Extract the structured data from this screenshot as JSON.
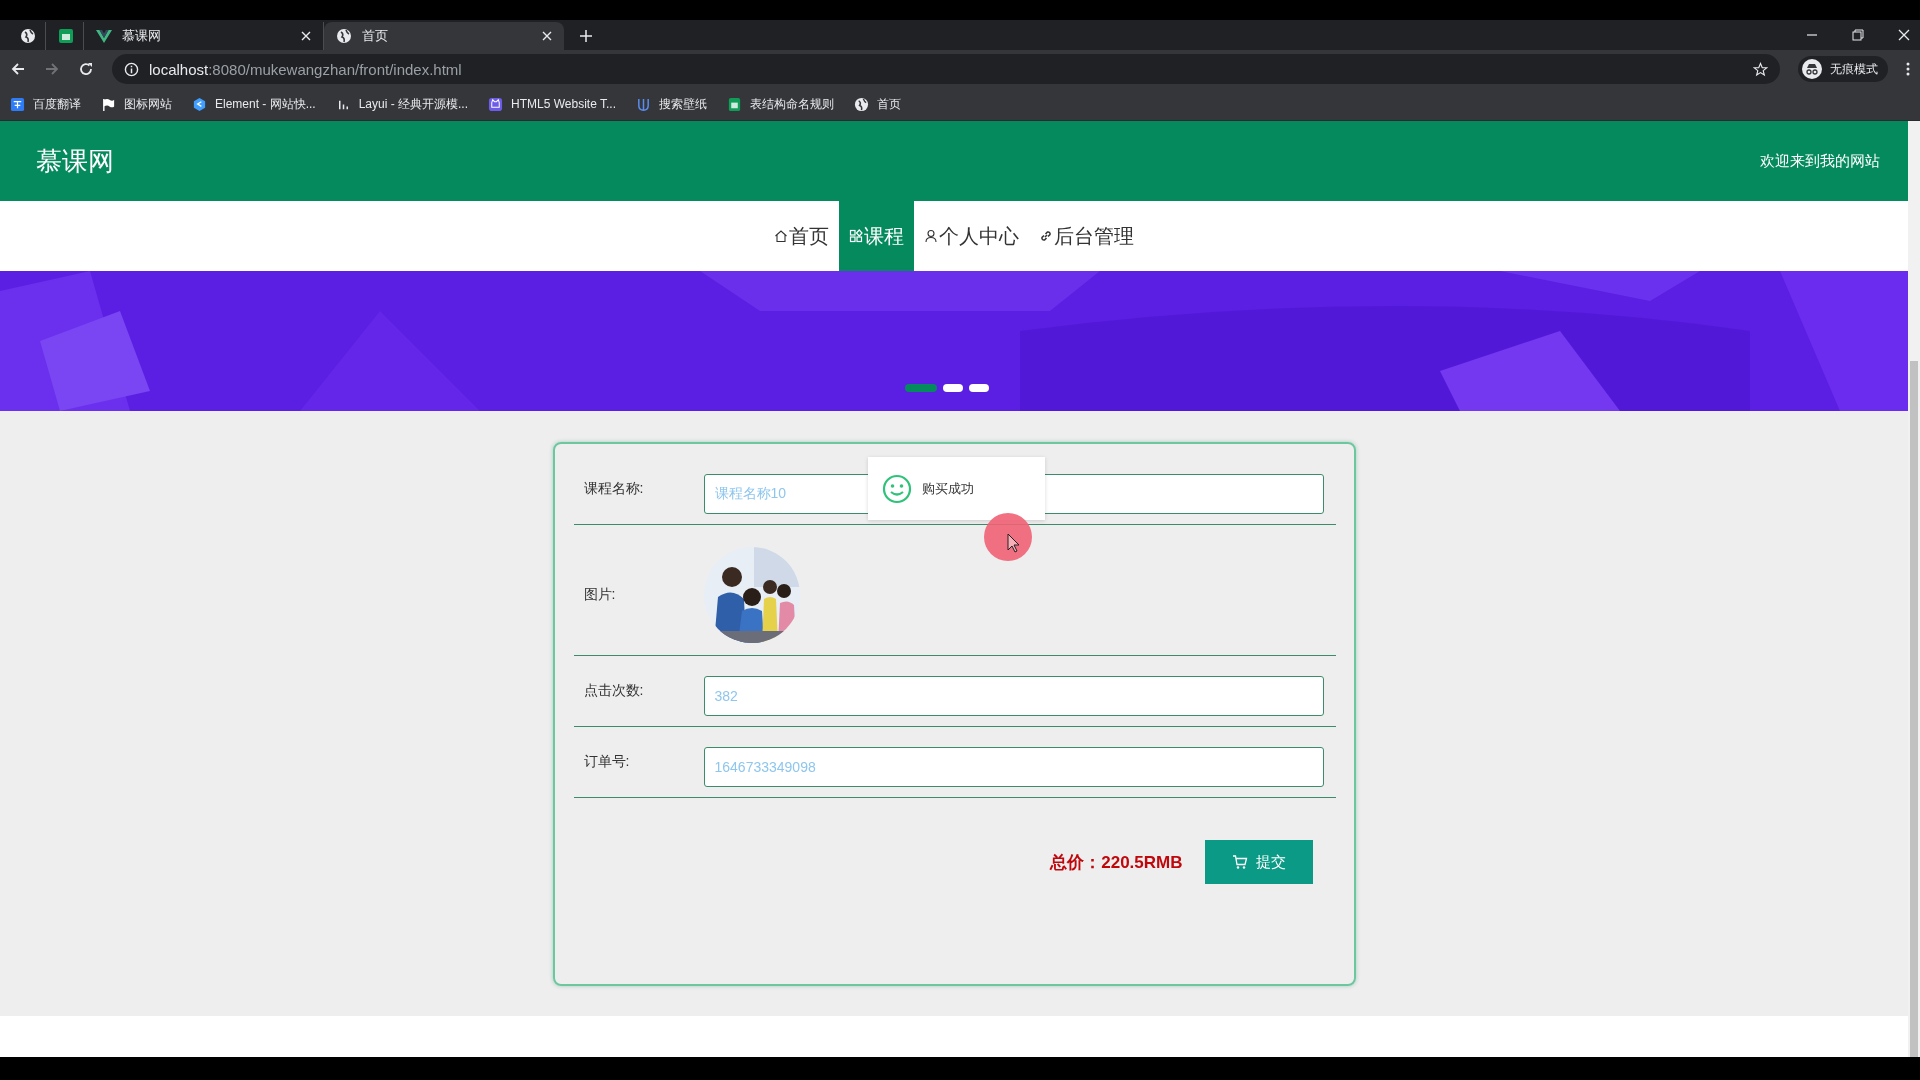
{
  "browser": {
    "tabs": [
      {
        "kind": "globe",
        "selected": false
      },
      {
        "kind": "sheet",
        "selected": false
      },
      {
        "kind": "vue",
        "title": "慕课网",
        "selected": false
      },
      {
        "kind": "globe",
        "title": "首页",
        "selected": true
      }
    ],
    "url": {
      "host": "localhost",
      "path": ":8080/mukewangzhan/front/index.html"
    },
    "profile": "无痕模式",
    "bookmarks": [
      {
        "kind": "translate",
        "label": "百度翻译"
      },
      {
        "kind": "flag",
        "label": "图标网站"
      },
      {
        "kind": "hexagon",
        "label": "Element - 网站快..."
      },
      {
        "kind": "layui",
        "label": "Layui - 经典开源模..."
      },
      {
        "kind": "cat",
        "label": "HTML5 Website T..."
      },
      {
        "kind": "trident",
        "label": "搜索壁纸"
      },
      {
        "kind": "sheet",
        "label": "表结构命名规则"
      },
      {
        "kind": "globe",
        "label": "首页"
      }
    ]
  },
  "header": {
    "brand": "慕课网",
    "welcome": "欢迎来到我的网站"
  },
  "nav": [
    {
      "kind": "home",
      "label": "首页",
      "selected": false
    },
    {
      "kind": "grid",
      "label": "课程",
      "selected": true
    },
    {
      "kind": "user",
      "label": "个人中心",
      "selected": false
    },
    {
      "kind": "link",
      "label": "后台管理",
      "selected": false
    }
  ],
  "carousel": {
    "dots": [
      {
        "selected": true
      },
      {
        "selected": false
      },
      {
        "selected": false
      }
    ]
  },
  "form": {
    "fields": [
      {
        "kind": "input",
        "label": "课程名称:",
        "value": "课程名称10"
      },
      {
        "label": "图片:"
      },
      {
        "kind": "input",
        "label": "点击次数:",
        "value": "382"
      },
      {
        "kind": "input",
        "label": "订单号:",
        "value": "1646733349098"
      }
    ],
    "total_label": "总价：",
    "total_value": "220.5RMB",
    "submit": "提交"
  },
  "toast": {
    "message": "购买成功"
  }
}
